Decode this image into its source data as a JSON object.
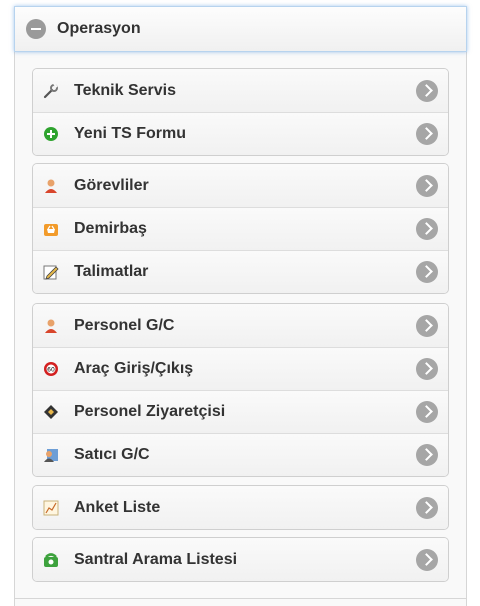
{
  "header": {
    "title": "Operasyon",
    "toggle_icon": "minus-circle-icon"
  },
  "colors": {
    "header_glow": "#5696dc",
    "arrow": "#a6a6a6",
    "text": "#333333"
  },
  "groups": [
    {
      "items": [
        {
          "label": "Teknik Servis",
          "icon": "wrench-icon"
        },
        {
          "label": "Yeni TS Formu",
          "icon": "plus-circle-icon"
        }
      ]
    },
    {
      "items": [
        {
          "label": "Görevliler",
          "icon": "user-icon"
        },
        {
          "label": "Demirbaş",
          "icon": "basket-icon"
        },
        {
          "label": "Talimatlar",
          "icon": "pencil-icon"
        }
      ]
    },
    {
      "items": [
        {
          "label": "Personel G/C",
          "icon": "user-icon"
        },
        {
          "label": "Araç Giriş/Çıkış",
          "icon": "speed-limit-icon"
        },
        {
          "label": "Personel Ziyaretçisi",
          "icon": "diamond-icon"
        },
        {
          "label": "Satıcı G/C",
          "icon": "id-card-icon"
        }
      ]
    },
    {
      "items": [
        {
          "label": "Anket Liste",
          "icon": "chart-icon"
        }
      ]
    },
    {
      "items": [
        {
          "label": "Santral Arama Listesi",
          "icon": "telephone-icon"
        }
      ]
    }
  ]
}
